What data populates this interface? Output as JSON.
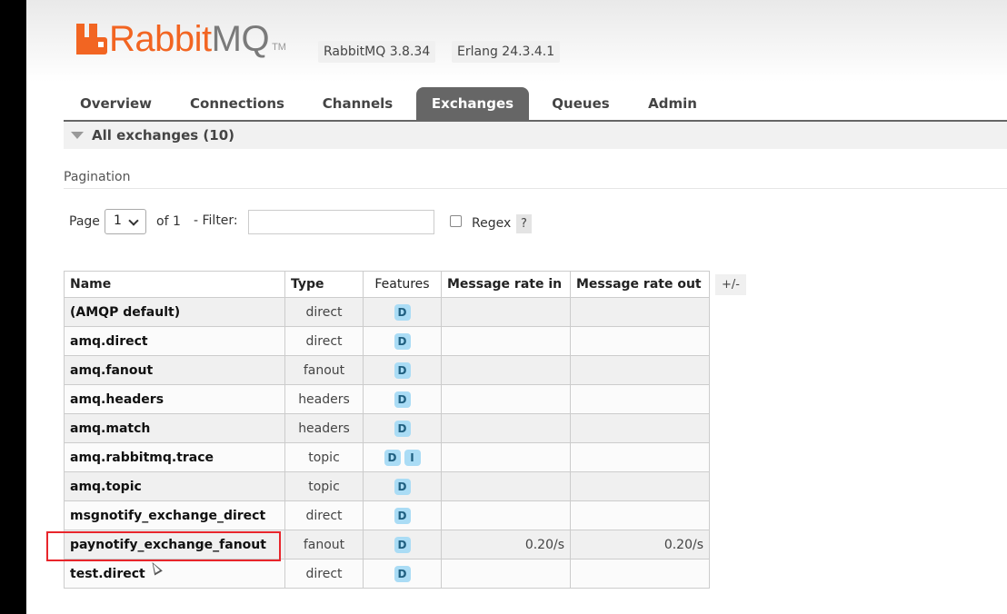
{
  "app": {
    "logo_rabbit": "Rabbit",
    "logo_mq": "MQ",
    "logo_tm": "TM",
    "rabbitmq_version": "RabbitMQ 3.8.34",
    "erlang_version": "Erlang 24.3.4.1",
    "brand_color": "#f26522"
  },
  "tabs": [
    {
      "label": "Overview",
      "active": false
    },
    {
      "label": "Connections",
      "active": false
    },
    {
      "label": "Channels",
      "active": false
    },
    {
      "label": "Exchanges",
      "active": true
    },
    {
      "label": "Queues",
      "active": false
    },
    {
      "label": "Admin",
      "active": false
    }
  ],
  "section": {
    "title": "All exchanges (10)"
  },
  "pagination": {
    "label": "Pagination",
    "page_label": "Page",
    "page_value": "1",
    "of_label": "of 1",
    "filter_label": "- Filter:",
    "filter_value": "",
    "regex_label": "Regex",
    "regex_checked": false,
    "help_label": "?"
  },
  "table": {
    "headers": {
      "name": "Name",
      "type": "Type",
      "features": "Features",
      "rate_in": "Message rate in",
      "rate_out": "Message rate out"
    },
    "toggle_columns": "+/-",
    "rows": [
      {
        "name": "(AMQP default)",
        "type": "direct",
        "features": [
          "D"
        ],
        "rate_in": "",
        "rate_out": ""
      },
      {
        "name": "amq.direct",
        "type": "direct",
        "features": [
          "D"
        ],
        "rate_in": "",
        "rate_out": ""
      },
      {
        "name": "amq.fanout",
        "type": "fanout",
        "features": [
          "D"
        ],
        "rate_in": "",
        "rate_out": ""
      },
      {
        "name": "amq.headers",
        "type": "headers",
        "features": [
          "D"
        ],
        "rate_in": "",
        "rate_out": ""
      },
      {
        "name": "amq.match",
        "type": "headers",
        "features": [
          "D"
        ],
        "rate_in": "",
        "rate_out": ""
      },
      {
        "name": "amq.rabbitmq.trace",
        "type": "topic",
        "features": [
          "D",
          "I"
        ],
        "rate_in": "",
        "rate_out": ""
      },
      {
        "name": "amq.topic",
        "type": "topic",
        "features": [
          "D"
        ],
        "rate_in": "",
        "rate_out": ""
      },
      {
        "name": "msgnotify_exchange_direct",
        "type": "direct",
        "features": [
          "D"
        ],
        "rate_in": "",
        "rate_out": ""
      },
      {
        "name": "paynotify_exchange_fanout",
        "type": "fanout",
        "features": [
          "D"
        ],
        "rate_in": "0.20/s",
        "rate_out": "0.20/s",
        "highlighted": true
      },
      {
        "name": "test.direct",
        "type": "direct",
        "features": [
          "D"
        ],
        "rate_in": "",
        "rate_out": ""
      }
    ]
  },
  "colors": {
    "highlight": "#e8252b",
    "feature_badge": "#aadcf5",
    "active_tab": "#666666"
  }
}
